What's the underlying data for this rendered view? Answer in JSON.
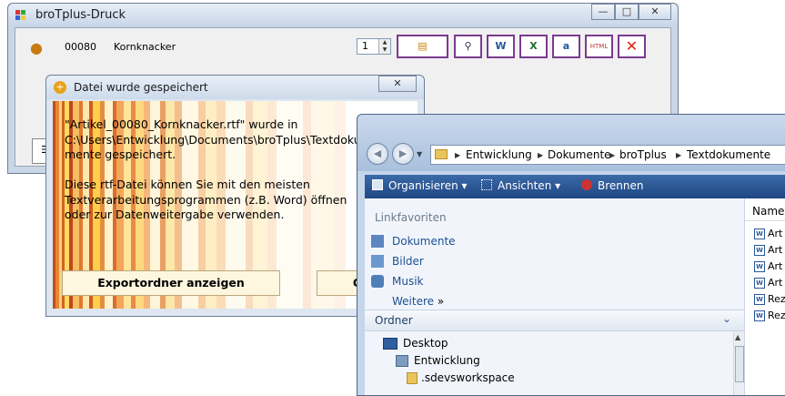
{
  "druck": {
    "title": "broTplus-Druck",
    "article_no": "00080",
    "article_name": "Kornknacker",
    "copies": "1",
    "toolbar_icons": [
      "list-icon",
      "preview-icon",
      "word-export-icon",
      "excel-export-icon",
      "text-export-icon",
      "html-export-icon",
      "close-icon"
    ]
  },
  "saved_dialog": {
    "title": "Datei wurde gespeichert",
    "message_lines": [
      "\"Artikel_00080_Kornknacker.rtf\" wurde in",
      "C:\\Users\\Entwicklung\\Documents\\broTplus\\Textdoku",
      "mente gespeichert.",
      "",
      "Diese rtf-Datei können Sie mit den meisten",
      "Textverarbeitungsprogrammen (z.B. Word) öffnen",
      "oder zur Datenweitergabe verwenden."
    ],
    "btn_export": "Exportordner anzeigen",
    "btn_ok": "OK"
  },
  "explorer": {
    "breadcrumb": [
      "Entwicklung",
      "Dokumente",
      "broTplus",
      "Textdokumente"
    ],
    "commands": {
      "organize": "Organisieren",
      "views": "Ansichten",
      "burn": "Brennen"
    },
    "fav_header": "Linkfavoriten",
    "favorites": [
      "Dokumente",
      "Bilder",
      "Musik"
    ],
    "more": "Weitere",
    "folders_header": "Ordner",
    "tree": [
      "Desktop",
      "Entwicklung",
      ".sdevsworkspace"
    ],
    "column_name": "Name",
    "files": [
      "Art",
      "Art",
      "Art",
      "Art",
      "Rez",
      "Rez"
    ]
  }
}
